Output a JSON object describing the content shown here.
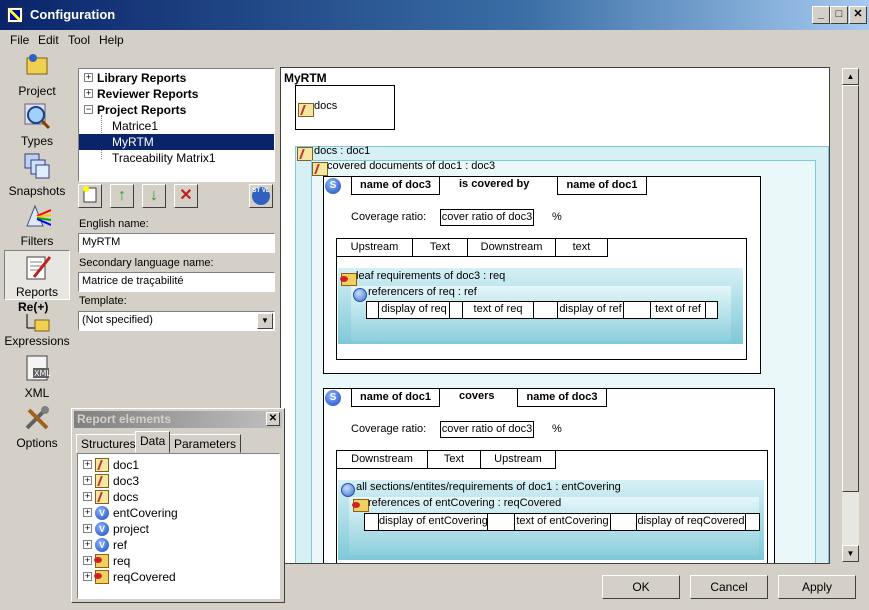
{
  "window": {
    "title": "Configuration",
    "min": "_",
    "max": "□",
    "close": "✕"
  },
  "menu": [
    "File",
    "Edit",
    "Tool",
    "Help"
  ],
  "sidebar": [
    {
      "label": "Project",
      "icon": "project-icon"
    },
    {
      "label": "Types",
      "icon": "magnifier-icon"
    },
    {
      "label": "Snapshots",
      "icon": "snapshots-icon"
    },
    {
      "label": "Filters",
      "icon": "prism-icon"
    },
    {
      "label": "Reports",
      "icon": "report-pen-icon"
    },
    {
      "label": "Expressions",
      "icon": "regex-icon",
      "top_label": "Re(+)"
    },
    {
      "label": "XML",
      "icon": "xml-icon"
    },
    {
      "label": "Options",
      "icon": "tools-icon"
    }
  ],
  "report_tree": {
    "groups": [
      "Library Reports",
      "Reviewer Reports",
      "Project Reports"
    ],
    "items": [
      "Matrice1",
      "MyRTM",
      "Traceability Matrix1"
    ],
    "selected": "MyRTM"
  },
  "toolbar": {
    "stvl": "ST VL"
  },
  "form": {
    "english_label": "English name:",
    "english_value": "MyRTM",
    "secondary_label": "Secondary language name:",
    "secondary_value": "Matrice de traçabilité",
    "template_label": "Template:",
    "template_value": "(Not specified)"
  },
  "elements_panel": {
    "title": "Report elements",
    "tabs": [
      "Structures",
      "Data",
      "Parameters"
    ],
    "active_tab": "Data",
    "items": [
      {
        "label": "doc1",
        "icon": "doc"
      },
      {
        "label": "doc3",
        "icon": "doc"
      },
      {
        "label": "docs",
        "icon": "doc"
      },
      {
        "label": "entCovering",
        "icon": "var"
      },
      {
        "label": "project",
        "icon": "var"
      },
      {
        "label": "ref",
        "icon": "var"
      },
      {
        "label": "req",
        "icon": "req"
      },
      {
        "label": "reqCovered",
        "icon": "req"
      }
    ]
  },
  "canvas": {
    "title": "MyRTM",
    "docs_box": "docs",
    "loop1": "docs : doc1",
    "loop2": "covered documents of doc1 : doc3",
    "sec1": {
      "h1": "name of doc3",
      "h2": "is covered by",
      "h3": "name of doc1",
      "coverage_label": "Coverage ratio:",
      "coverage_value": "cover ratio of doc3",
      "pct": "%",
      "cols": [
        "Upstream",
        "Text",
        "Downstream",
        "text"
      ],
      "loop": "leaf requirements of doc3 : req",
      "subloop": "referencers of req : ref",
      "cells": [
        "display of req",
        "text of req",
        "display of ref",
        "text of ref"
      ]
    },
    "sec2": {
      "h1": "name of doc1",
      "h2": "covers",
      "h3": "name of doc3",
      "coverage_label": "Coverage ratio:",
      "coverage_value": "cover ratio of doc3",
      "pct": "%",
      "cols": [
        "Downstream",
        "Text",
        "Upstream"
      ],
      "loop": "all sections/entites/requirements of doc1 : entCovering",
      "subloop": "references of entCovering : reqCovered",
      "cells": [
        "display of entCovering",
        "text of entCovering",
        "display of reqCovered"
      ]
    }
  },
  "buttons": {
    "ok": "OK",
    "cancel": "Cancel",
    "apply": "Apply"
  }
}
